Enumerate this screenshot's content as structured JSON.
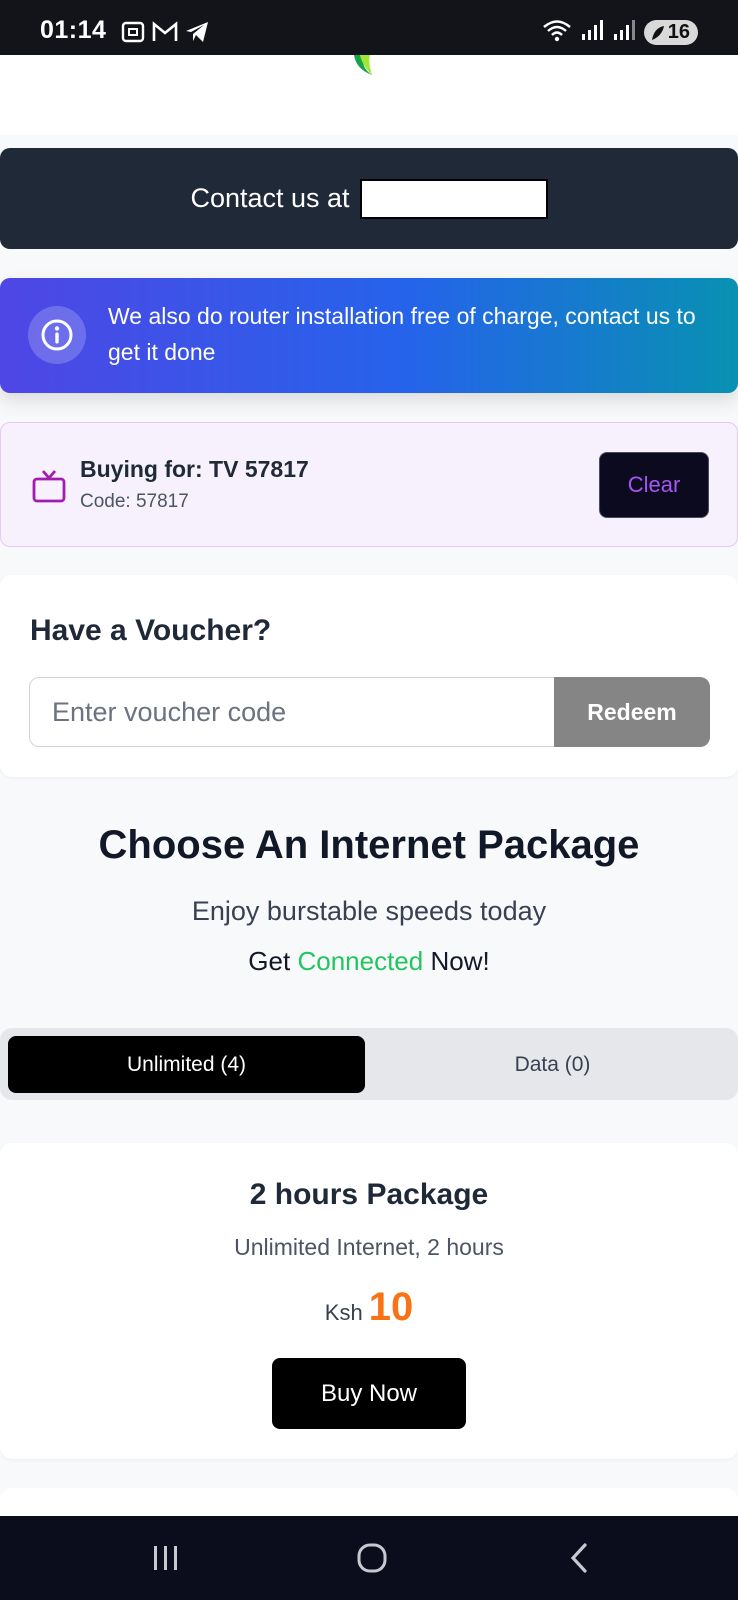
{
  "status_bar": {
    "time": "01:14",
    "battery": "16",
    "icons_left": [
      "screenshot-icon",
      "gmail-icon",
      "telegram-icon"
    ],
    "icons_right": [
      "wifi-icon",
      "signal-icon",
      "signal-icon",
      "battery-icon"
    ]
  },
  "contact": {
    "label": "Contact us at"
  },
  "info_banner": {
    "text": "We also do router installation free of charge, contact us to get it done",
    "icon": "info-icon"
  },
  "buying_for": {
    "title": "Buying for: TV 57817",
    "code": "Code: 57817",
    "clear_label": "Clear",
    "icon": "tv-icon"
  },
  "voucher": {
    "title": "Have a Voucher?",
    "placeholder": "Enter voucher code",
    "redeem_label": "Redeem"
  },
  "packages_header": {
    "title": "Choose An Internet Package",
    "subtitle": "Enjoy burstable speeds today",
    "tagline_prefix": "Get",
    "tagline_highlight": "Connected",
    "tagline_suffix": "Now!"
  },
  "tabs": [
    {
      "label": "Unlimited (4)",
      "active": true
    },
    {
      "label": "Data (0)",
      "active": false
    }
  ],
  "package": {
    "title": "2 hours Package",
    "description": "Unlimited Internet, 2 hours",
    "currency": "Ksh",
    "price": "10",
    "buy_label": "Buy Now"
  },
  "colors": {
    "dark_banner": "#1f2937",
    "gradient_start": "#4f46e5",
    "gradient_end": "#0891b2",
    "accent_green": "#22c55e",
    "price_orange": "#f97316",
    "clear_purple": "#a855f7"
  },
  "nav": {
    "icons": [
      "recent-apps-icon",
      "home-icon",
      "back-icon"
    ]
  }
}
